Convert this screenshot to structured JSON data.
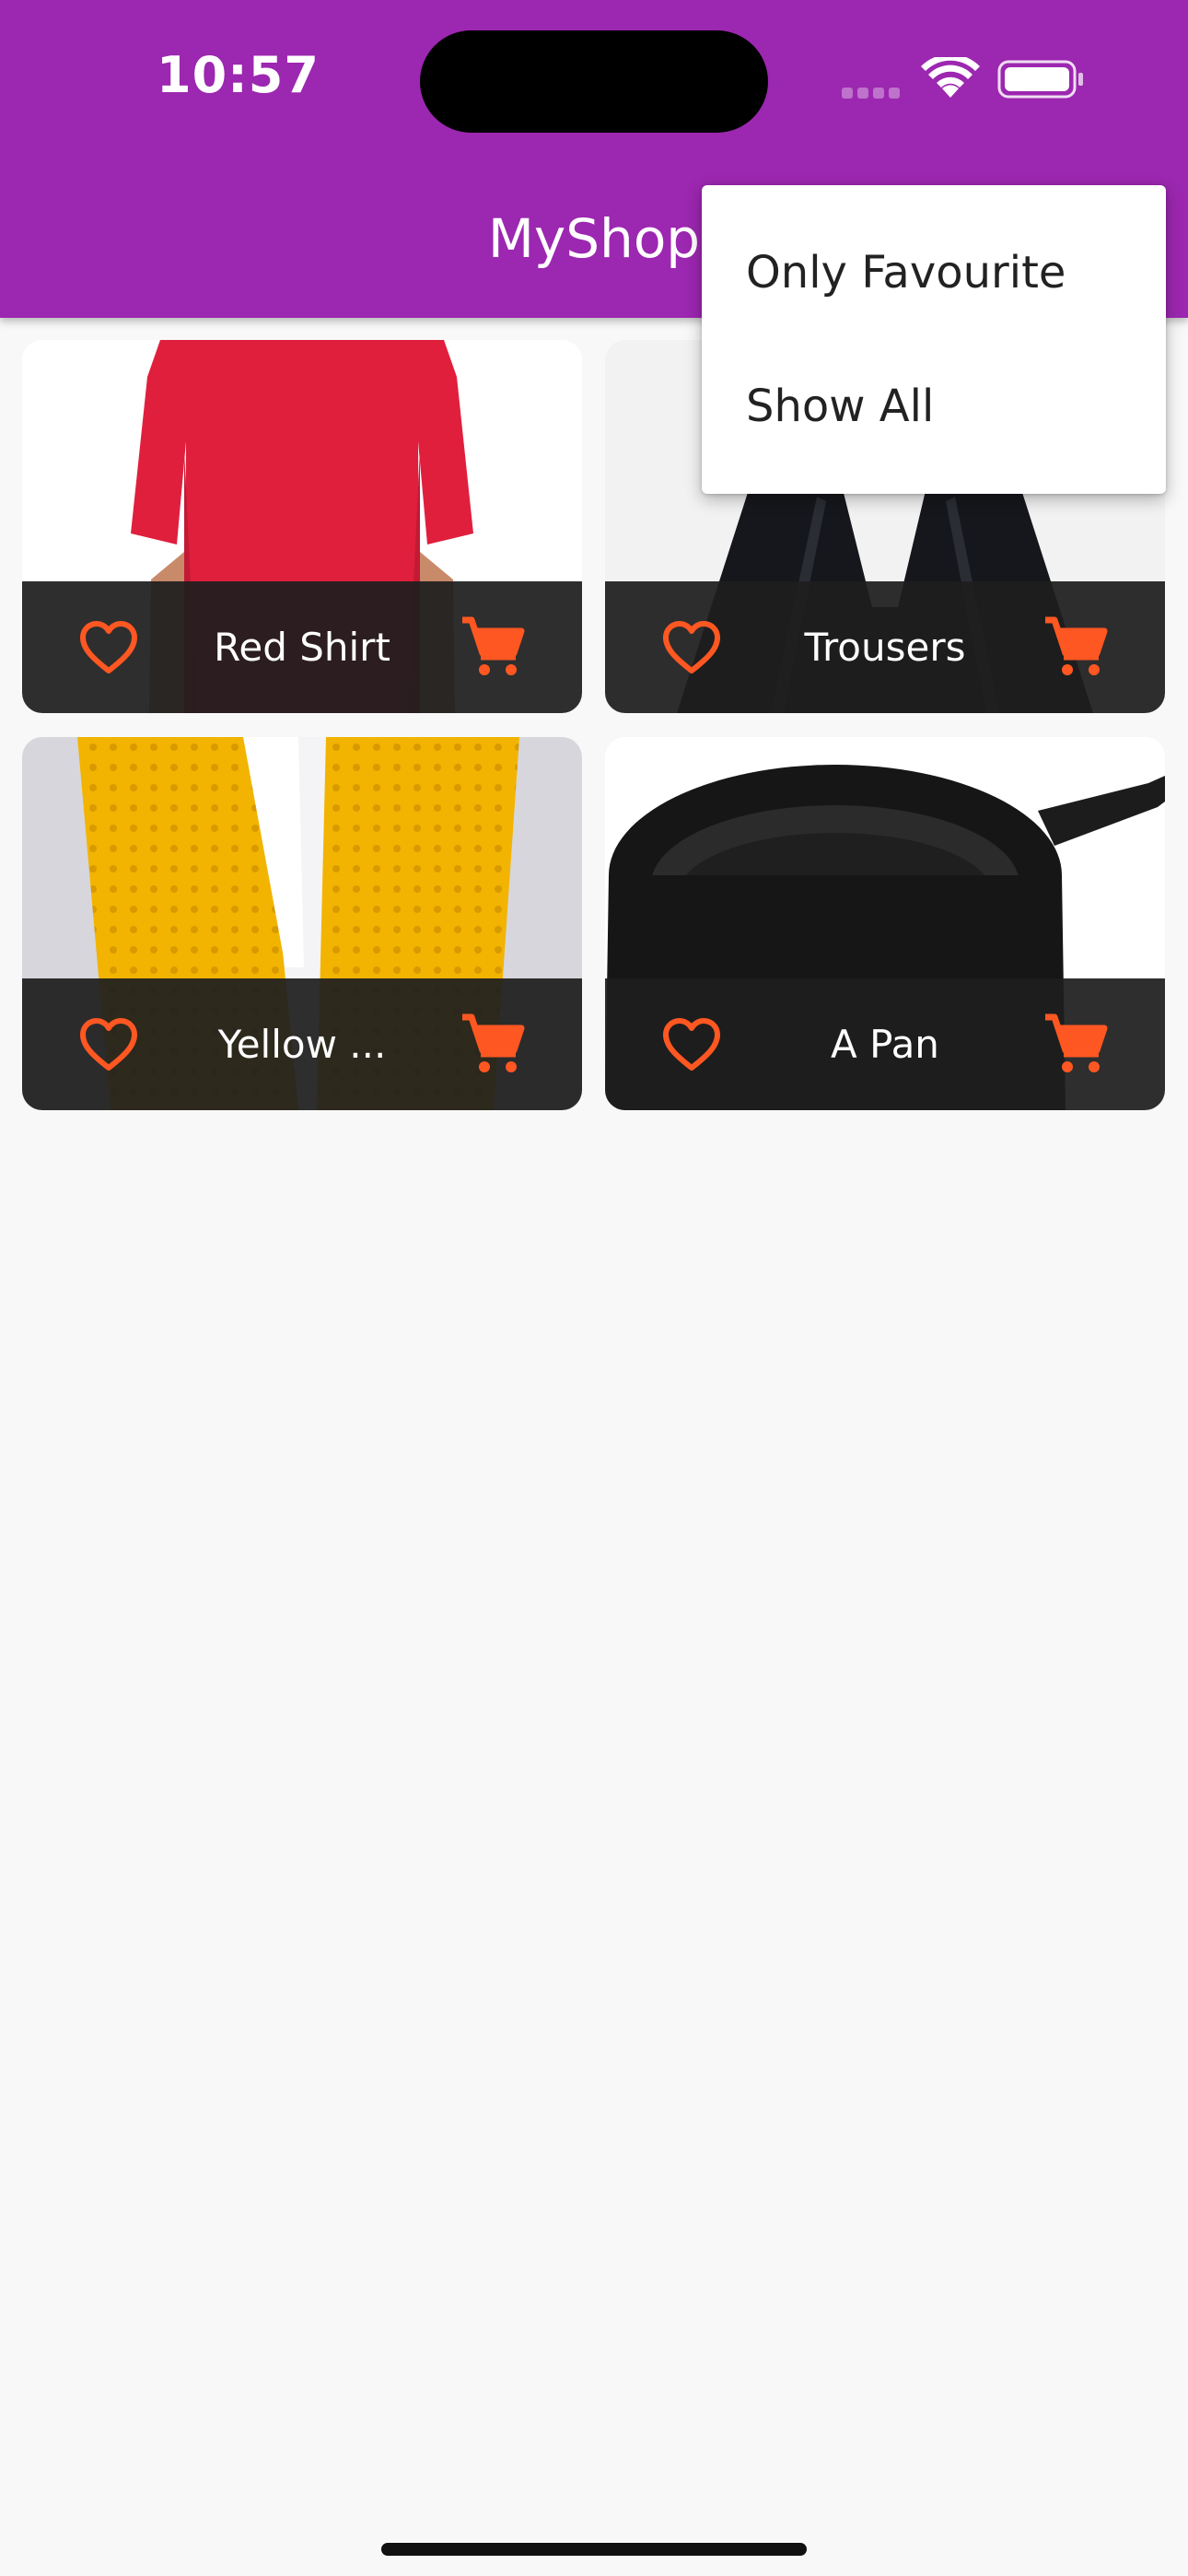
{
  "status_bar": {
    "time": "10:57",
    "wifi_icon": "wifi-icon",
    "battery_icon": "battery-icon"
  },
  "app_bar": {
    "title": "MyShop",
    "color": "#9c27b0"
  },
  "menu": {
    "items": [
      {
        "label": "Only Favourite"
      },
      {
        "label": "Show All"
      }
    ]
  },
  "products": [
    {
      "title": "Red Shirt",
      "image": "red-shirt-image",
      "favourite_icon": "heart-outline-icon",
      "cart_icon": "cart-icon"
    },
    {
      "title": "Trousers",
      "image": "trousers-image",
      "favourite_icon": "heart-outline-icon",
      "cart_icon": "cart-icon"
    },
    {
      "title": "Yellow ...",
      "image": "yellow-scarf-image",
      "favourite_icon": "heart-outline-icon",
      "cart_icon": "cart-icon"
    },
    {
      "title": "A Pan",
      "image": "pan-image",
      "favourite_icon": "heart-outline-icon",
      "cart_icon": "cart-icon"
    }
  ],
  "colors": {
    "accent": "#ff5722",
    "card_footer": "#1e1e1e",
    "background": "#f8f8f8"
  }
}
